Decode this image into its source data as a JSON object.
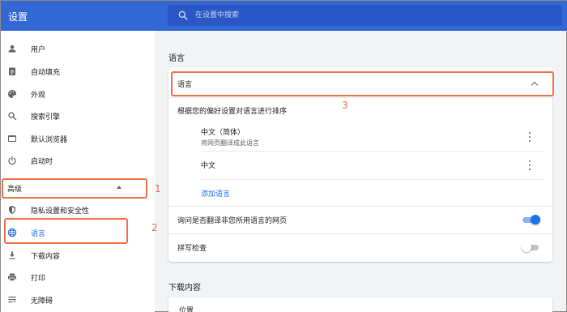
{
  "app": {
    "title": "设置"
  },
  "search": {
    "placeholder": "在设置中搜索"
  },
  "sidebar": {
    "items": [
      {
        "label": "用户",
        "icon": "person-icon"
      },
      {
        "label": "自动填充",
        "icon": "clipboard-icon"
      },
      {
        "label": "外观",
        "icon": "palette-icon"
      },
      {
        "label": "搜索引擎",
        "icon": "search-icon"
      },
      {
        "label": "默认浏览器",
        "icon": "browser-icon"
      },
      {
        "label": "启动时",
        "icon": "power-icon"
      }
    ],
    "advanced": {
      "label": "高级",
      "expanded": true
    },
    "advanced_items": [
      {
        "label": "隐私设置和安全性",
        "icon": "shield-icon"
      },
      {
        "label": "语言",
        "icon": "globe-icon",
        "active": true
      },
      {
        "label": "下载内容",
        "icon": "download-icon"
      },
      {
        "label": "打印",
        "icon": "printer-icon"
      },
      {
        "label": "无障碍",
        "icon": "accessibility-icon"
      }
    ]
  },
  "main": {
    "section_title": "语言",
    "card": {
      "header": "语言",
      "order_label": "根据您的偏好设置对语言进行排序",
      "languages": [
        {
          "name": "中文（简体）",
          "note": "将网页翻译成此语言"
        },
        {
          "name": "中文",
          "note": ""
        }
      ],
      "add_link": "添加语言",
      "translate_offer": {
        "label": "询问是否翻译非您所用语言的网页",
        "on": true
      },
      "spell_check": {
        "label": "拼写检查",
        "on": false
      }
    },
    "downloads_title": "下载内容",
    "downloads_first_row": "位置"
  },
  "annotations": [
    "1",
    "2",
    "3"
  ],
  "colors": {
    "topbar": "#3367d6",
    "accent": "#1a73e8",
    "highlight": "#ef6f4a",
    "background": "#f1f3f4"
  }
}
